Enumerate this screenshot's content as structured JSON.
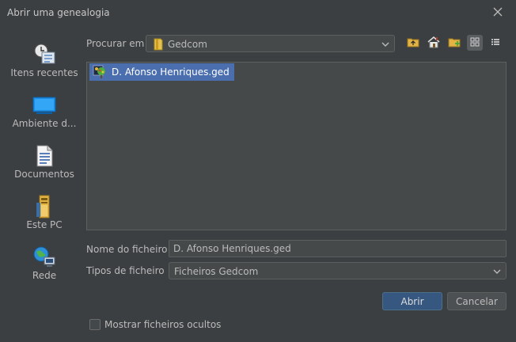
{
  "window": {
    "title": "Abrir uma genealogia"
  },
  "places": [
    {
      "label": "Itens recentes",
      "icon": "recent-items-icon"
    },
    {
      "label": "Ambiente d...",
      "icon": "desktop-icon"
    },
    {
      "label": "Documentos",
      "icon": "documents-icon"
    },
    {
      "label": "Este PC",
      "icon": "computer-icon"
    },
    {
      "label": "Rede",
      "icon": "network-icon"
    }
  ],
  "lookin": {
    "label": "Procurar em",
    "value": "Gedcom"
  },
  "toolbar": {
    "up": "up-folder-icon",
    "home": "home-icon",
    "new_folder": "new-folder-icon",
    "list_view": "list-view-icon",
    "details_view": "details-view-icon"
  },
  "files": [
    {
      "name": "D. Afonso Henriques.ged",
      "icon": "gedcom-file-icon",
      "selected": true
    }
  ],
  "filename": {
    "label": "Nome do ficheiro",
    "value": "D. Afonso Henriques.ged"
  },
  "filetype": {
    "label": "Tipos de ficheiro",
    "value": "Ficheiros Gedcom"
  },
  "buttons": {
    "open": "Abrir",
    "cancel": "Cancelar"
  },
  "show_hidden": {
    "label": "Mostrar ficheiros ocultos",
    "checked": false
  },
  "colors": {
    "background": "#3c3f41",
    "selection": "#4b6eaf",
    "primary_button": "#365880"
  }
}
